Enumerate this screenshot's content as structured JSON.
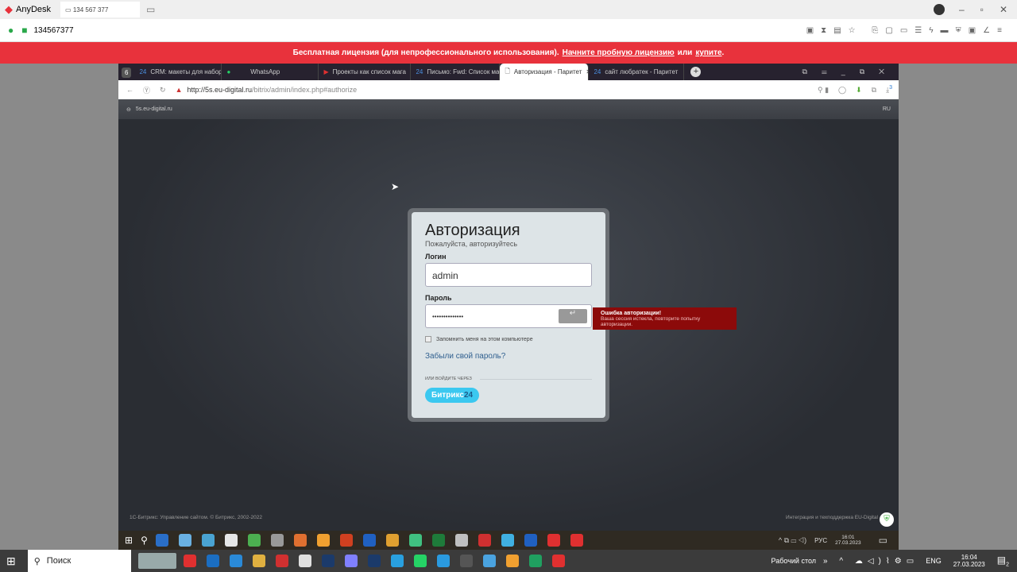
{
  "anydesk": {
    "app_name": "AnyDesk",
    "tab_address": "134 567 377",
    "session_id": "134567377"
  },
  "banner": {
    "text": "Бесплатная лицензия (для непрофессионального использования).",
    "trial_link": "Начните пробную лицензию",
    "or": "или",
    "buy_link": "купите",
    "end": "."
  },
  "browser": {
    "tab_count": "6",
    "tabs": [
      {
        "label": "CRM: макеты для наборов"
      },
      {
        "label": "WhatsApp"
      },
      {
        "label": "Проекты как список мага"
      },
      {
        "label": "Письмо: Fwd: Список маг"
      },
      {
        "label": "Авторизация - Паритет",
        "active": true
      },
      {
        "label": "сайт любратек - Паритет"
      }
    ],
    "url_host": "http://5s.eu-digital.ru",
    "url_path": "/bitrix/admin/index.php#authorize",
    "download_badge": "3"
  },
  "site": {
    "name": "5s.eu-digital.ru",
    "lang": "RU",
    "footer_left": "1С-Битрикс: Управление сайтом. © Битрикс, 2002-2022",
    "footer_right": "Интеграция и техподдержка EU-Digital"
  },
  "login": {
    "title": "Авторизация",
    "subtitle": "Пожалуйста, авторизуйтесь",
    "login_label": "Логин",
    "login_value": "admin",
    "password_label": "Пароль",
    "password_value": "••••••••••••••",
    "remember": "Запомнить меня на этом компьютере",
    "forgot": "Забыли свой пароль?",
    "or_via": "ИЛИ ВОЙДИТЕ ЧЕРЕЗ",
    "bitrix": "Битрикс",
    "bitrix24": "24"
  },
  "error": {
    "title": "Ошибка авторизации!",
    "message": "Ваша сессия истекла, повторите попытку авторизации."
  },
  "remote_tray": {
    "lang": "РУС",
    "time": "16:01",
    "date": "27.03.2023"
  },
  "local_taskbar": {
    "search": "Поиск",
    "desktop": "Рабочий стол",
    "lang": "ENG",
    "time": "16:04",
    "date": "27.03.2023",
    "notifications": "2"
  },
  "remote_icons": [
    "#2a6ec6",
    "#6ab0e0",
    "#4aa3d0",
    "#e6e6e6",
    "#4caf50",
    "#999",
    "#e07030",
    "#f0a030",
    "#d04020",
    "#2060c0",
    "#e0a030",
    "#40c080",
    "#1e7b3a",
    "#c0c0c0",
    "#d03030",
    "#40b0e0",
    "#2060c0",
    "#e03030",
    "#e03030"
  ],
  "local_icons": [
    "#e03030",
    "#1b6ec2",
    "#2a8ad8",
    "#e0b040",
    "#d03030",
    "#e0e0e0",
    "#1b3a6a",
    "#8080ff",
    "#1b3a6a",
    "#29a0e0",
    "#25d366",
    "#2a9ae0",
    "#555",
    "#4aa3e0",
    "#f0a030",
    "#20a060",
    "#e03030"
  ]
}
